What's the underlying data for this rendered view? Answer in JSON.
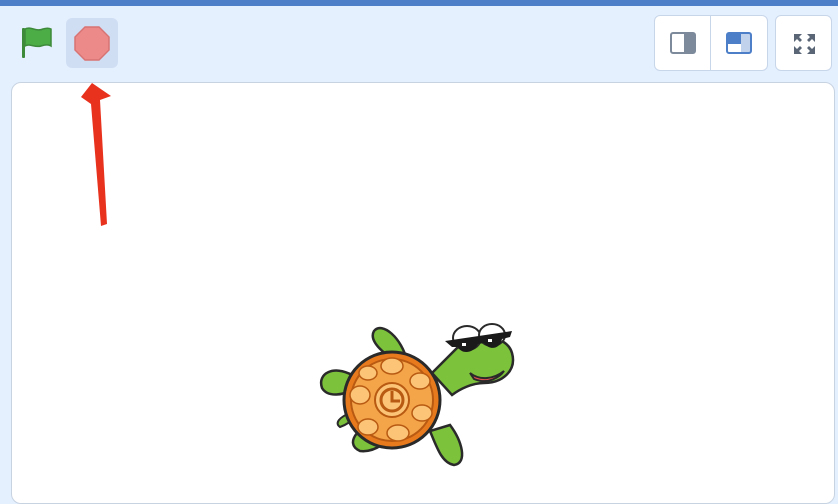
{
  "toolbar": {
    "buttons": [
      {
        "name": "green-flag",
        "icon": "green-flag-icon",
        "color": "#4cad47"
      },
      {
        "name": "stop",
        "icon": "stop-sign-icon",
        "color": "#ec8a8a",
        "highlighted": true
      }
    ],
    "layout_buttons": [
      {
        "name": "small-stage",
        "icon": "small-stage-icon",
        "selected": false
      },
      {
        "name": "normal-stage",
        "icon": "large-stage-icon",
        "selected": true
      }
    ],
    "fullscreen": {
      "icon": "fullscreen-icon"
    }
  },
  "stage": {
    "sprite": {
      "name": "turtle",
      "icon": "turtle-sprite"
    }
  },
  "annotation": {
    "type": "arrow",
    "color": "#e8321e",
    "points_to": "stop-button"
  },
  "colors": {
    "accent": "#4d7fc9",
    "toolbar_bg": "#e5f0ff",
    "stage_bg": "#ffffff"
  }
}
